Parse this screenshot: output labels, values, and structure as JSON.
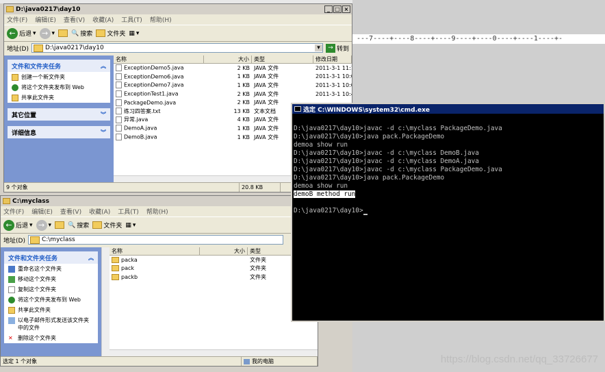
{
  "background": {
    "ruler_text": "---7----+----8----+----9----+----0----+----1----+-",
    "watermark": "https://blog.csdn.net/qq_33726677"
  },
  "win1": {
    "title": "D:\\java0217\\day10",
    "menus": [
      "文件(F)",
      "编辑(E)",
      "查看(V)",
      "收藏(A)",
      "工具(T)",
      "帮助(H)"
    ],
    "toolbar": {
      "back": "后退",
      "search": "搜索",
      "folders": "文件夹"
    },
    "address_label": "地址(D)",
    "address_value": "D:\\java0217\\day10",
    "go_label": "转到",
    "tasks": [
      {
        "title": "文件和文件夹任务",
        "items": [
          "创建一个新文件夹",
          "将这个文件夹发布到 Web",
          "共享此文件夹"
        ]
      },
      {
        "title": "其它位置",
        "items": []
      },
      {
        "title": "详细信息",
        "items": []
      }
    ],
    "columns": [
      "名称",
      "大小",
      "类型",
      "修改日期"
    ],
    "files": [
      {
        "name": "ExceptionDemo5.java",
        "size": "2 KB",
        "type": "JAVA 文件",
        "date": "2011-3-1 11:1"
      },
      {
        "name": "ExceptionDemo6.java",
        "size": "1 KB",
        "type": "JAVA 文件",
        "date": "2011-3-1 10:0"
      },
      {
        "name": "ExceptionDemo7.java",
        "size": "1 KB",
        "type": "JAVA 文件",
        "date": "2011-3-1 10:0"
      },
      {
        "name": "ExceptionTest1.java",
        "size": "2 KB",
        "type": "JAVA 文件",
        "date": "2011-3-1 10:4"
      },
      {
        "name": "PackageDemo.java",
        "size": "2 KB",
        "type": "JAVA 文件",
        "date": ""
      },
      {
        "name": "练习四答案.txt",
        "size": "13 KB",
        "type": "文本文档",
        "date": ""
      },
      {
        "name": "异常.java",
        "size": "4 KB",
        "type": "JAVA 文件",
        "date": ""
      },
      {
        "name": "DemoA.java",
        "size": "1 KB",
        "type": "JAVA 文件",
        "date": ""
      },
      {
        "name": "DemoB.java",
        "size": "1 KB",
        "type": "JAVA 文件",
        "date": ""
      }
    ],
    "status": {
      "count": "9 个对象",
      "size": "20.8 KB"
    }
  },
  "win2": {
    "title": "C:\\myclass",
    "menus": [
      "文件(F)",
      "编辑(E)",
      "查看(V)",
      "收藏(A)",
      "工具(T)",
      "帮助(H)"
    ],
    "toolbar": {
      "back": "后退",
      "search": "搜索",
      "folders": "文件夹"
    },
    "address_label": "地址(D)",
    "address_value": "C:\\myclass",
    "tasks_title": "文件和文件夹任务",
    "tasks": [
      "重命名这个文件夹",
      "移动这个文件夹",
      "复制这个文件夹",
      "将这个文件夹发布到 Web",
      "共享此文件夹",
      "以电子邮件形式发送该文件夹中的文件",
      "删除这个文件夹"
    ],
    "columns": [
      "名称",
      "大小",
      "类型"
    ],
    "folders": [
      {
        "name": "packa",
        "type": "文件夹"
      },
      {
        "name": "pack",
        "type": "文件夹"
      },
      {
        "name": "packb",
        "type": "文件夹"
      }
    ],
    "status": {
      "selection": "选定 1 个对象",
      "location": "我的电脑"
    }
  },
  "cmd": {
    "title": "选定 C:\\WINDOWS\\system32\\cmd.exe",
    "lines": [
      "D:\\java0217\\day10>javac -d c:\\myclass PackageDemo.java",
      "",
      "D:\\java0217\\day10>java pack.PackageDemo",
      "demoa show run",
      "",
      "D:\\java0217\\day10>javac -d c:\\myclass DemoB.java",
      "",
      "D:\\java0217\\day10>javac -d c:\\myclass DemoA.java",
      "",
      "D:\\java0217\\day10>javac -d c:\\myclass PackageDemo.java",
      "",
      "D:\\java0217\\day10>java pack.PackageDemo",
      "demoa show run"
    ],
    "selected_line": "demoB method run",
    "prompt": "D:\\java0217\\day10>"
  }
}
